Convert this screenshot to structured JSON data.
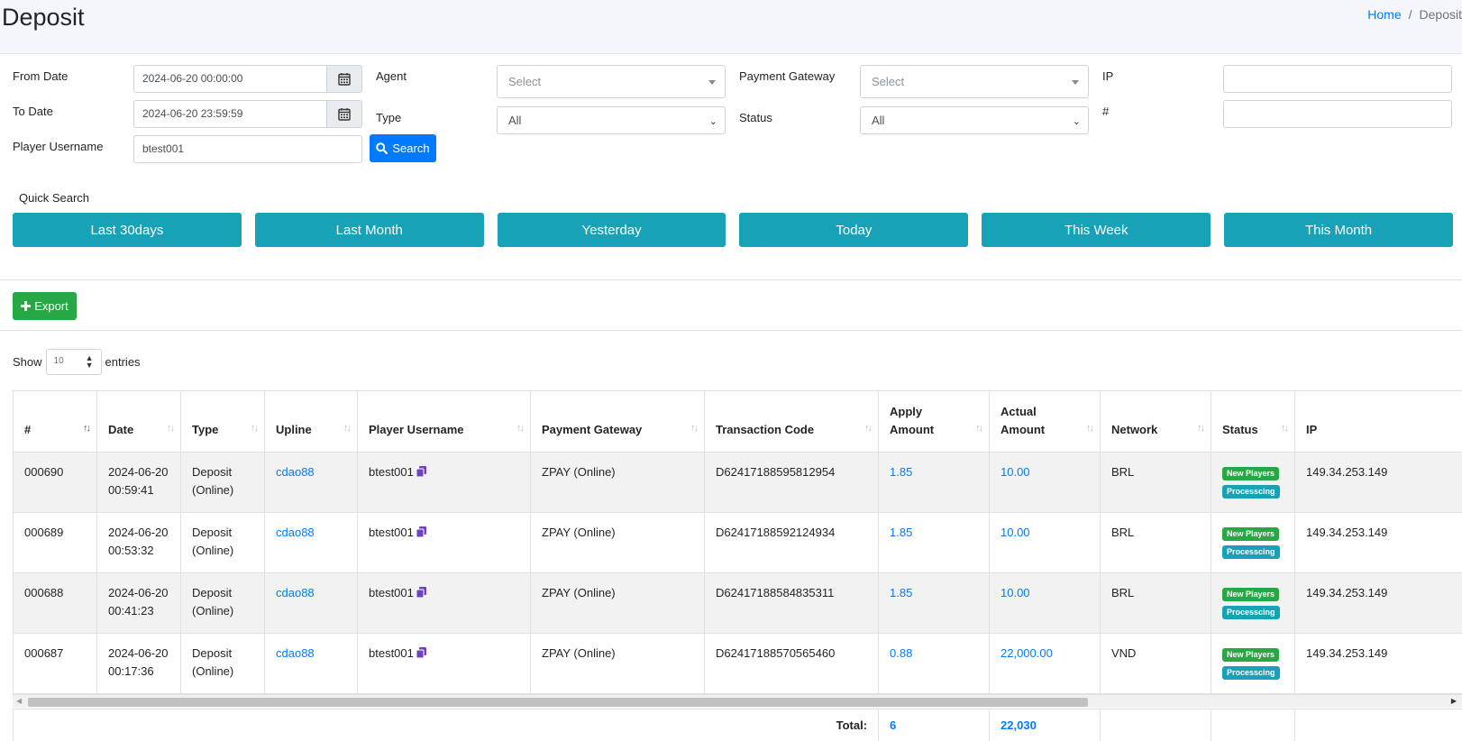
{
  "header": {
    "title": "Deposit",
    "breadcrumb_home": "Home",
    "breadcrumb_sep": "/",
    "breadcrumb_current": "Deposit"
  },
  "filters": {
    "from_date_label": "From Date",
    "from_date_value": "2024-06-20 00:00:00",
    "to_date_label": "To Date",
    "to_date_value": "2024-06-20 23:59:59",
    "player_label": "Player Username",
    "player_value": "btest001",
    "agent_label": "Agent",
    "agent_placeholder": "Select",
    "type_label": "Type",
    "type_value": "All",
    "gateway_label": "Payment Gateway",
    "gateway_placeholder": "Select",
    "status_label": "Status",
    "status_value": "All",
    "ip_label": "IP",
    "ip_value": "",
    "hash_label": "#",
    "hash_value": "",
    "search_label": "Search"
  },
  "quick": {
    "label": "Quick Search",
    "buttons": [
      "Last 30days",
      "Last Month",
      "Yesterday",
      "Today",
      "This Week",
      "This Month"
    ]
  },
  "export_label": "Export",
  "length": {
    "show": "Show",
    "value": "10",
    "entries": "entries"
  },
  "table": {
    "columns": [
      "#",
      "Date",
      "Type",
      "Upline",
      "Player Username",
      "Payment Gateway",
      "Transaction Code",
      "Apply Amount",
      "Actual Amount",
      "Network",
      "Status",
      "IP"
    ],
    "rows": [
      {
        "id": "000690",
        "date": "2024-06-20",
        "time": "00:59:41",
        "type1": "Deposit",
        "type2": "(Online)",
        "upline": "cdao88",
        "player": "btest001",
        "gateway": "ZPAY (Online)",
        "code": "D62417188595812954",
        "apply": "1.85",
        "actual": "10.00",
        "network": "BRL",
        "badge1": "New Players",
        "badge2": "Processcing",
        "ip": "149.34.253.149"
      },
      {
        "id": "000689",
        "date": "2024-06-20",
        "time": "00:53:32",
        "type1": "Deposit",
        "type2": "(Online)",
        "upline": "cdao88",
        "player": "btest001",
        "gateway": "ZPAY (Online)",
        "code": "D62417188592124934",
        "apply": "1.85",
        "actual": "10.00",
        "network": "BRL",
        "badge1": "New Players",
        "badge2": "Processcing",
        "ip": "149.34.253.149"
      },
      {
        "id": "000688",
        "date": "2024-06-20",
        "time": "00:41:23",
        "type1": "Deposit",
        "type2": "(Online)",
        "upline": "cdao88",
        "player": "btest001",
        "gateway": "ZPAY (Online)",
        "code": "D62417188584835311",
        "apply": "1.85",
        "actual": "10.00",
        "network": "BRL",
        "badge1": "New Players",
        "badge2": "Processcing",
        "ip": "149.34.253.149"
      },
      {
        "id": "000687",
        "date": "2024-06-20",
        "time": "00:17:36",
        "type1": "Deposit",
        "type2": "(Online)",
        "upline": "cdao88",
        "player": "btest001",
        "gateway": "ZPAY (Online)",
        "code": "D62417188570565460",
        "apply": "0.88",
        "actual": "22,000.00",
        "network": "VND",
        "badge1": "New Players",
        "badge2": "Processcing",
        "ip": "149.34.253.149"
      }
    ],
    "total_label": "Total:",
    "total_apply": "6",
    "total_actual": "22,030"
  },
  "colors": {
    "primary": "#007bff",
    "info": "#17a2b8",
    "success": "#28a745"
  }
}
